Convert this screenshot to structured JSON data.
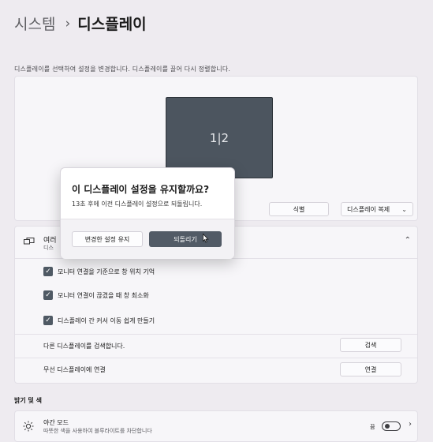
{
  "breadcrumb": {
    "parent": "시스템",
    "separator": "›",
    "current": "디스플레이"
  },
  "arrangement": {
    "instructions": "디스플레이를 선택하여 설정을 변경합니다. 디스플레이를 끌어 다시 정렬합니다.",
    "monitor_label": "1|2",
    "identify_label": "식별",
    "duplicate_select_value": "디스플레이 복제"
  },
  "multiple_displays": {
    "title": "여러",
    "subtitle": "디스",
    "checkboxes": [
      {
        "label": "모니터 연결을 기준으로 창 위치 기억",
        "checked": true
      },
      {
        "label": "모니터 연결이 끊겼을 때 창 최소화",
        "checked": true
      },
      {
        "label": "디스플레이 간 커서 이동 쉽게 만들기",
        "checked": true
      }
    ],
    "detect_label": "다른 디스플레이를 검색합니다.",
    "detect_button": "검색",
    "wireless_label": "무선 디스플레이에 연결",
    "wireless_button": "연결"
  },
  "brightness_section": {
    "title": "밝기 및 색",
    "night_light": {
      "title": "야간 모드",
      "subtitle": "따뜻한 색을 사용하여 블루라이트를 차단합니다",
      "state": "끔"
    }
  },
  "dialog": {
    "title": "이 디스플레이 설정을 유지할까요?",
    "message": "13초 후에 이전 디스플레이 설정으로 되돌립니다.",
    "keep_button": "변경한 설정 유지",
    "revert_button": "되돌리기"
  },
  "icons": {
    "checkmark": "check-icon",
    "chevron_down": "chevron-down-icon",
    "chevron_up": "chevron-up-icon",
    "chevron_right": "chevron-right-icon",
    "multi_display": "multi-display-icon",
    "brightness": "brightness-icon",
    "cursor": "cursor-icon"
  },
  "colors": {
    "accent": "#525b66",
    "background": "#eeebf0",
    "monitor": "#4c555f"
  }
}
